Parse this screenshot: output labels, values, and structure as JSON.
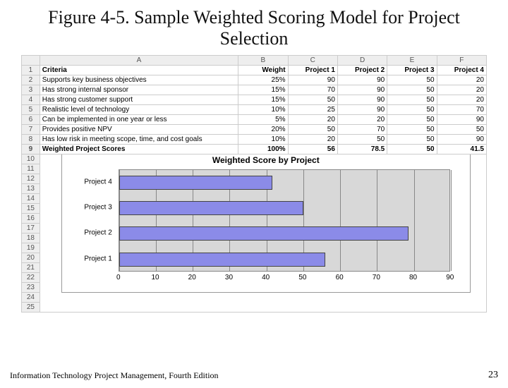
{
  "title": "Figure 4-5. Sample Weighted Scoring Model for Project Selection",
  "columns": [
    "",
    "A",
    "B",
    "C",
    "D",
    "E",
    "F"
  ],
  "header_row": {
    "criteria": "Criteria",
    "weight": "Weight",
    "p1": "Project 1",
    "p2": "Project 2",
    "p3": "Project 3",
    "p4": "Project 4"
  },
  "rows": [
    {
      "n": "2",
      "c": "Supports key business objectives",
      "w": "25%",
      "p1": "90",
      "p2": "90",
      "p3": "50",
      "p4": "20"
    },
    {
      "n": "3",
      "c": "Has strong internal sponsor",
      "w": "15%",
      "p1": "70",
      "p2": "90",
      "p3": "50",
      "p4": "20"
    },
    {
      "n": "4",
      "c": "Has strong customer support",
      "w": "15%",
      "p1": "50",
      "p2": "90",
      "p3": "50",
      "p4": "20"
    },
    {
      "n": "5",
      "c": "Realistic level of technology",
      "w": "10%",
      "p1": "25",
      "p2": "90",
      "p3": "50",
      "p4": "70"
    },
    {
      "n": "6",
      "c": "Can be implemented in one year or less",
      "w": "5%",
      "p1": "20",
      "p2": "20",
      "p3": "50",
      "p4": "90"
    },
    {
      "n": "7",
      "c": "Provides positive NPV",
      "w": "20%",
      "p1": "50",
      "p2": "70",
      "p3": "50",
      "p4": "50"
    },
    {
      "n": "8",
      "c": "Has low risk in meeting scope, time, and cost goals",
      "w": "10%",
      "p1": "20",
      "p2": "50",
      "p3": "50",
      "p4": "90"
    }
  ],
  "totals": {
    "n": "9",
    "label": "Weighted Project Scores",
    "w": "100%",
    "p1": "56",
    "p2": "78.5",
    "p3": "50",
    "p4": "41.5"
  },
  "empty_rows": [
    "10",
    "11",
    "12",
    "13",
    "14",
    "15",
    "16",
    "17",
    "18",
    "19",
    "20",
    "21",
    "22",
    "23",
    "24",
    "25"
  ],
  "chart_data": {
    "type": "bar",
    "orientation": "horizontal",
    "title": "Weighted Score by Project",
    "categories": [
      "Project 4",
      "Project 3",
      "Project 2",
      "Project 1"
    ],
    "values": [
      41.5,
      50,
      78.5,
      56
    ],
    "xlabel": "",
    "ylabel": "",
    "xlim": [
      0,
      90
    ],
    "xticks": [
      0,
      10,
      20,
      30,
      40,
      50,
      60,
      70,
      80,
      90
    ],
    "bar_color": "#8b8be8",
    "plot_bg": "#d8d8d8"
  },
  "footer_left": "Information Technology Project Management, Fourth Edition",
  "footer_right": "23"
}
